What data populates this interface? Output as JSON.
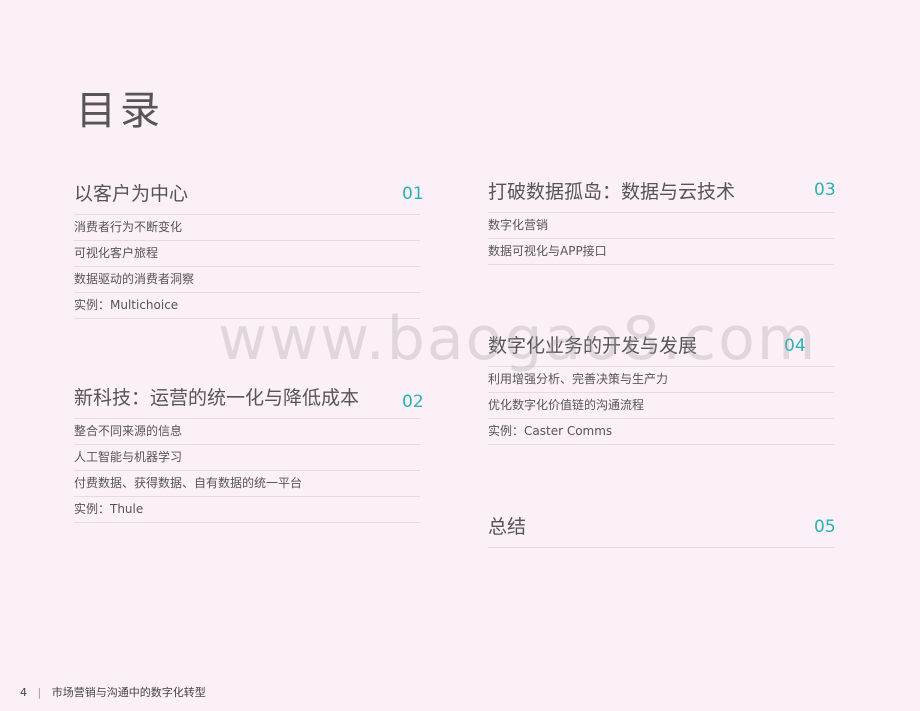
{
  "page": {
    "title": "目录",
    "watermark": "www.baogao8.com",
    "footer": {
      "page_number": "4",
      "separator": "|",
      "doc_title": "市场营销与沟通中的数字化转型"
    }
  },
  "sections": [
    {
      "title": "以客户为中心",
      "number": "01",
      "items": [
        "消费者行为不断变化",
        "可视化客户旅程",
        "数据驱动的消费者洞察",
        "实例：Multichoice"
      ]
    },
    {
      "title": "新科技：运营的统一化与降低成本",
      "number": "02",
      "items": [
        "整合不同来源的信息",
        "人工智能与机器学习",
        "付费数据、获得数据、自有数据的统一平台",
        "实例：Thule"
      ]
    },
    {
      "title": "打破数据孤岛：数据与云技术",
      "number": "03",
      "items": [
        "数字化营销",
        "数据可视化与APP接口"
      ]
    },
    {
      "title": "数字化业务的开发与发展",
      "number": "04",
      "items": [
        "利用增强分析、完善决策与生产力",
        "优化数字化价值链的沟通流程",
        "实例：Caster Comms"
      ]
    },
    {
      "title": "总结",
      "number": "05",
      "items": []
    }
  ]
}
